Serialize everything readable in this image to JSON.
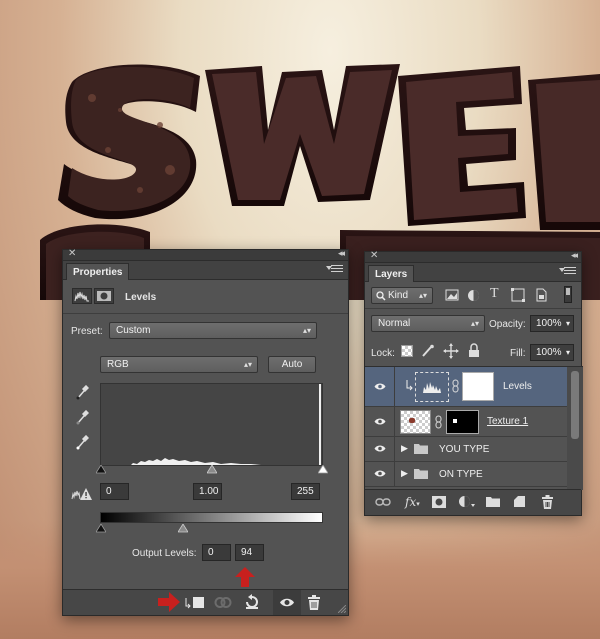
{
  "properties": {
    "tab": "Properties",
    "title": "Levels",
    "preset_label": "Preset:",
    "preset_value": "Custom",
    "channel_value": "RGB",
    "auto_label": "Auto",
    "input_black": "0",
    "input_gamma": "1.00",
    "input_white": "255",
    "output_label": "Output Levels:",
    "output_black": "0",
    "output_white": "94"
  },
  "layers": {
    "tab": "Layers",
    "kind_label": "Kind",
    "blend_mode": "Normal",
    "opacity_label": "Opacity:",
    "opacity_value": "100%",
    "lock_label": "Lock:",
    "fill_label": "Fill:",
    "fill_value": "100%",
    "items": [
      {
        "name": "Levels"
      },
      {
        "name": "Texture 1"
      },
      {
        "name": "YOU TYPE"
      },
      {
        "name": "ON TYPE"
      }
    ]
  },
  "colors": {
    "accent_arrow": "#c8201e",
    "selected_row": "#55657e"
  }
}
